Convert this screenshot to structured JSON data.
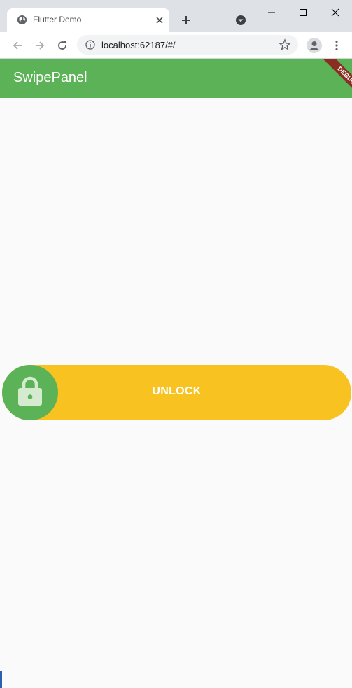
{
  "browser": {
    "tab_title": "Flutter Demo",
    "url": "localhost:62187/#/"
  },
  "app": {
    "title": "SwipePanel",
    "debug_banner": "DEBUG"
  },
  "swipe_panel": {
    "label": "UNLOCK",
    "handle_icon": "lock-icon",
    "colors": {
      "panel": "#f8c221",
      "handle": "#5cb257",
      "label": "#ffffff"
    }
  },
  "colors": {
    "appbar": "#5cb257",
    "background": "#fafafa",
    "tabstrip": "#dee1e6"
  }
}
